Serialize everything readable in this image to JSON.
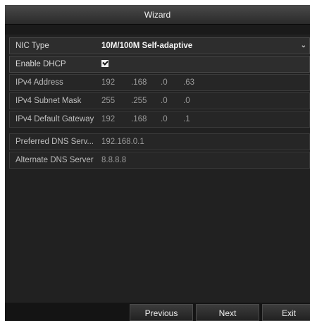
{
  "window": {
    "title": "Wizard"
  },
  "form": {
    "nic_type": {
      "label": "NIC Type",
      "value": "10M/100M Self-adaptive"
    },
    "enable_dhcp": {
      "label": "Enable DHCP",
      "checked": true
    },
    "ipv4_address": {
      "label": "IPv4 Address",
      "octets": [
        "192",
        ".168",
        ".0",
        ".63"
      ]
    },
    "ipv4_subnet_mask": {
      "label": "IPv4 Subnet Mask",
      "octets": [
        "255",
        ".255",
        ".0",
        ".0"
      ]
    },
    "ipv4_default_gateway": {
      "label": "IPv4 Default Gateway",
      "octets": [
        "192",
        ".168",
        ".0",
        ".1"
      ]
    },
    "preferred_dns": {
      "label": "Preferred DNS Serv...",
      "value": "192.168.0.1"
    },
    "alternate_dns": {
      "label": "Alternate DNS Server",
      "value": "8.8.8.8"
    }
  },
  "footer": {
    "previous_label": "Previous",
    "next_label": "Next",
    "exit_label": "Exit"
  },
  "icons": {
    "dropdown": "chevron-down-icon",
    "checkbox": "checkmark-icon"
  },
  "colors": {
    "background": "#212121",
    "titlebar": "#3a3a3a",
    "text": "#bdbdbd"
  }
}
